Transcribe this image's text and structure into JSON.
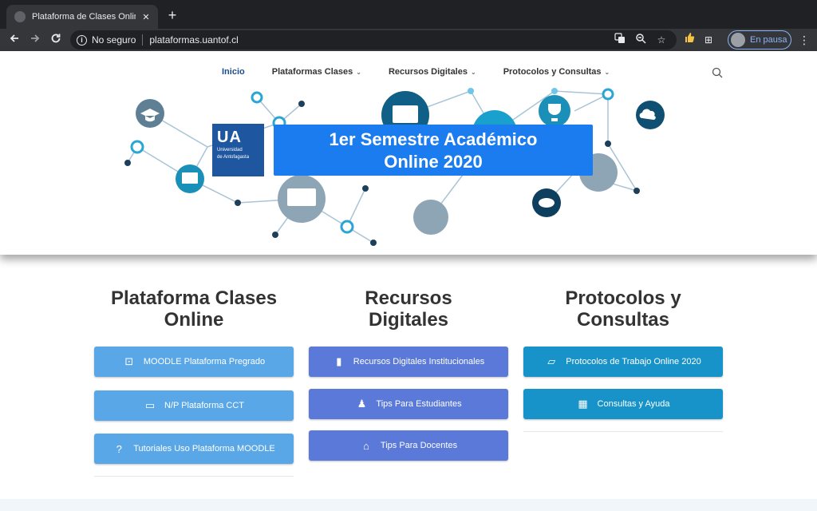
{
  "browser": {
    "tab_title": "Plataforma de Clases Online – U",
    "tab_close": "✕",
    "new_tab": "+",
    "security_label": "No seguro",
    "url": "plataformas.uantof.cl",
    "profile_label": "En pausa",
    "icons": {
      "back": "back-arrow-icon",
      "forward": "forward-arrow-icon",
      "reload": "reload-icon",
      "translate": "translate-icon",
      "zoom": "zoom-icon",
      "bookmark": "star-icon",
      "extension1": "thumbs-up-icon",
      "extension2": "grid-icon",
      "menu": "kebab-menu-icon"
    }
  },
  "nav": {
    "items": [
      {
        "label": "Inicio"
      },
      {
        "label": "Plataformas Clases"
      },
      {
        "label": "Recursos Digitales"
      },
      {
        "label": "Protocolos y Consultas"
      }
    ],
    "chevron": "⌄"
  },
  "hero": {
    "logo_mark": "UA",
    "logo_line1": "Universidad",
    "logo_line2": "de Antofagasta",
    "banner_line1": "1er Semestre Académico",
    "banner_line2": "Online 2020"
  },
  "columns": [
    {
      "title_line1": "Plataforma Clases",
      "title_line2": "Online",
      "buttons": [
        {
          "label": "MOODLE Plataforma Pregrado",
          "icon": "chalkboard-teacher-icon",
          "glyph": "⊡"
        },
        {
          "label": "N/P Plataforma CCT",
          "icon": "desktop-icon",
          "glyph": "▭"
        },
        {
          "label": "Tutoriales Uso Plataforma MOODLE",
          "icon": "question-icon",
          "glyph": "?"
        }
      ]
    },
    {
      "title_line1": "Recursos",
      "title_line2": "Digitales",
      "buttons": [
        {
          "label": "Recursos Digitales Institucionales",
          "icon": "book-icon",
          "glyph": "▮"
        },
        {
          "label": "Tips Para Estudiantes",
          "icon": "graduate-icon",
          "glyph": "♟"
        },
        {
          "label": "Tips Para Docentes",
          "icon": "school-icon",
          "glyph": "⌂"
        }
      ]
    },
    {
      "title_line1": "Protocolos y",
      "title_line2": "Consultas",
      "buttons": [
        {
          "label": "Protocolos de Trabajo Online 2020",
          "icon": "folder-open-icon",
          "glyph": "▱"
        },
        {
          "label": "Consultas y Ayuda",
          "icon": "fax-icon",
          "glyph": "▦"
        }
      ]
    }
  ],
  "colors": {
    "banner_blue": "#1b7cf0",
    "logo_blue": "#1e56a0",
    "button_light_blue": "#5aa7e8",
    "button_purple": "#5a79d8",
    "button_teal": "#1893c9",
    "nav_active": "#1b4f8c"
  }
}
